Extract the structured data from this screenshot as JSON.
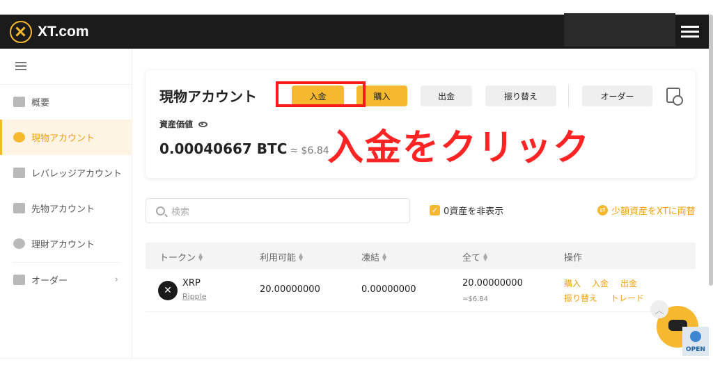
{
  "header": {
    "logo_text": "XT.com"
  },
  "sidebar": {
    "items": [
      {
        "label": "概要",
        "icon": "wallet-icon"
      },
      {
        "label": "現物アカウント",
        "icon": "pie-chart-icon"
      },
      {
        "label": "レバレッジアカウント",
        "icon": "sliders-icon"
      },
      {
        "label": "先物アカウント",
        "icon": "futures-icon"
      },
      {
        "label": "理財アカウント",
        "icon": "finance-icon"
      },
      {
        "label": "オーダー",
        "icon": "clipboard-icon"
      }
    ],
    "active_index": 1
  },
  "account_card": {
    "title": "現物アカウント",
    "buttons": {
      "deposit": "入金",
      "buy": "購入",
      "withdraw": "出金",
      "transfer": "振り替え",
      "orders": "オーダー"
    },
    "asset_label": "資産価値",
    "balance_btc": "0.00040667 BTC",
    "balance_usd": "≈ $6.84"
  },
  "annotation": {
    "text": "入金をクリック",
    "color": "#ff2424"
  },
  "filters": {
    "search_placeholder": "検索",
    "hide_zero_label": "0資産を非表示",
    "convert_label": "少額資産をXTに両替"
  },
  "table": {
    "headers": [
      "トークン",
      "利用可能",
      "凍結",
      "全て",
      "操作"
    ],
    "rows": [
      {
        "symbol": "XRP",
        "name": "Ripple",
        "available": "20.00000000",
        "frozen": "0.00000000",
        "total": "20.00000000",
        "total_usd": "≈$6.84",
        "actions": [
          "購入",
          "入金",
          "出金",
          "振り替え",
          "トレード"
        ]
      }
    ]
  },
  "widgets": {
    "open_badge": "OPEN"
  },
  "colors": {
    "accent": "#f5b82e",
    "accent_text": "#f0a00a",
    "topbar": "#1b1b1b",
    "highlight": "#ff1a1a"
  }
}
